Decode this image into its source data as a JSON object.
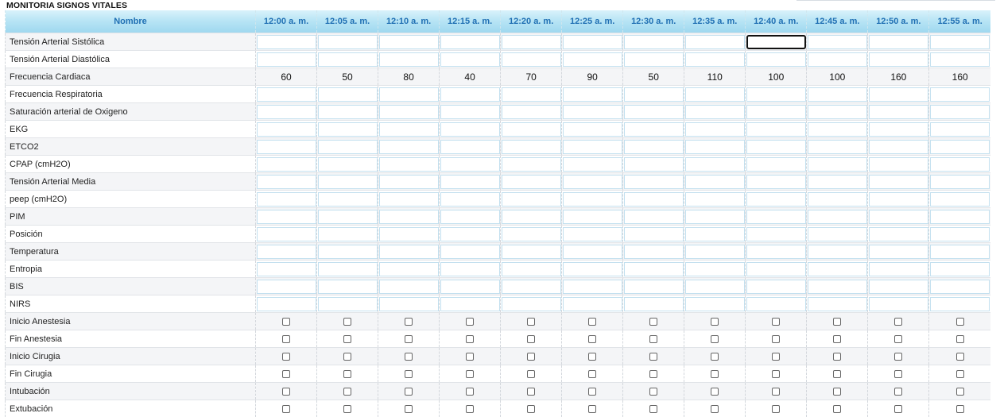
{
  "title": "MONITORIA SIGNOS VITALES",
  "header": {
    "name_label": "Nombre",
    "times": [
      "12:00 a. m.",
      "12:05 a. m.",
      "12:10 a. m.",
      "12:15 a. m.",
      "12:20 a. m.",
      "12:25 a. m.",
      "12:30 a. m.",
      "12:35 a. m.",
      "12:40 a. m.",
      "12:45 a. m.",
      "12:50 a. m.",
      "12:55 a. m."
    ]
  },
  "rows": [
    {
      "label": "Tensión Arterial Sistólica",
      "type": "input",
      "values": [
        "",
        "",
        "",
        "",
        "",
        "",
        "",
        "",
        "",
        "",
        "",
        ""
      ]
    },
    {
      "label": "Tensión Arterial Diastólica",
      "type": "input",
      "values": [
        "",
        "",
        "",
        "",
        "",
        "",
        "",
        "",
        "",
        "",
        "",
        ""
      ]
    },
    {
      "label": "Frecuencia Cardiaca",
      "type": "value",
      "values": [
        "60",
        "50",
        "80",
        "40",
        "70",
        "90",
        "50",
        "110",
        "100",
        "100",
        "160",
        "160"
      ]
    },
    {
      "label": "Frecuencia Respiratoria",
      "type": "input",
      "values": [
        "",
        "",
        "",
        "",
        "",
        "",
        "",
        "",
        "",
        "",
        "",
        ""
      ]
    },
    {
      "label": "Saturación arterial de Oxigeno",
      "type": "input",
      "values": [
        "",
        "",
        "",
        "",
        "",
        "",
        "",
        "",
        "",
        "",
        "",
        ""
      ]
    },
    {
      "label": "EKG",
      "type": "input",
      "values": [
        "",
        "",
        "",
        "",
        "",
        "",
        "",
        "",
        "",
        "",
        "",
        ""
      ]
    },
    {
      "label": "ETCO2",
      "type": "input",
      "values": [
        "",
        "",
        "",
        "",
        "",
        "",
        "",
        "",
        "",
        "",
        "",
        ""
      ]
    },
    {
      "label": "CPAP (cmH2O)",
      "type": "input",
      "values": [
        "",
        "",
        "",
        "",
        "",
        "",
        "",
        "",
        "",
        "",
        "",
        ""
      ]
    },
    {
      "label": "Tensión Arterial Media",
      "type": "input",
      "values": [
        "",
        "",
        "",
        "",
        "",
        "",
        "",
        "",
        "",
        "",
        "",
        ""
      ]
    },
    {
      "label": "peep (cmH2O)",
      "type": "input",
      "values": [
        "",
        "",
        "",
        "",
        "",
        "",
        "",
        "",
        "",
        "",
        "",
        ""
      ]
    },
    {
      "label": "PIM",
      "type": "input",
      "values": [
        "",
        "",
        "",
        "",
        "",
        "",
        "",
        "",
        "",
        "",
        "",
        ""
      ]
    },
    {
      "label": "Posición",
      "type": "input",
      "values": [
        "",
        "",
        "",
        "",
        "",
        "",
        "",
        "",
        "",
        "",
        "",
        ""
      ]
    },
    {
      "label": "Temperatura",
      "type": "input",
      "values": [
        "",
        "",
        "",
        "",
        "",
        "",
        "",
        "",
        "",
        "",
        "",
        ""
      ]
    },
    {
      "label": "Entropia",
      "type": "input",
      "values": [
        "",
        "",
        "",
        "",
        "",
        "",
        "",
        "",
        "",
        "",
        "",
        ""
      ]
    },
    {
      "label": "BIS",
      "type": "input",
      "values": [
        "",
        "",
        "",
        "",
        "",
        "",
        "",
        "",
        "",
        "",
        "",
        ""
      ]
    },
    {
      "label": "NIRS",
      "type": "input",
      "values": [
        "",
        "",
        "",
        "",
        "",
        "",
        "",
        "",
        "",
        "",
        "",
        ""
      ]
    },
    {
      "label": "Inicio Anestesia",
      "type": "checkbox",
      "values": [
        false,
        false,
        false,
        false,
        false,
        false,
        false,
        false,
        false,
        false,
        false,
        false
      ]
    },
    {
      "label": "Fin Anestesia",
      "type": "checkbox",
      "values": [
        false,
        false,
        false,
        false,
        false,
        false,
        false,
        false,
        false,
        false,
        false,
        false
      ]
    },
    {
      "label": "Inicio Cirugia",
      "type": "checkbox",
      "values": [
        false,
        false,
        false,
        false,
        false,
        false,
        false,
        false,
        false,
        false,
        false,
        false
      ]
    },
    {
      "label": "Fin Cirugia",
      "type": "checkbox",
      "values": [
        false,
        false,
        false,
        false,
        false,
        false,
        false,
        false,
        false,
        false,
        false,
        false
      ]
    },
    {
      "label": "Intubación",
      "type": "checkbox",
      "values": [
        false,
        false,
        false,
        false,
        false,
        false,
        false,
        false,
        false,
        false,
        false,
        false
      ]
    },
    {
      "label": "Extubación",
      "type": "checkbox",
      "values": [
        false,
        false,
        false,
        false,
        false,
        false,
        false,
        false,
        false,
        false,
        false,
        false
      ]
    }
  ],
  "focused_cell": {
    "row": 0,
    "col": 8
  },
  "colors": {
    "header_text": "#1f6fb3",
    "header_bg": "#b9e5f5",
    "input_border": "#c3e0ef",
    "row_alt": "#f4f5f7"
  }
}
